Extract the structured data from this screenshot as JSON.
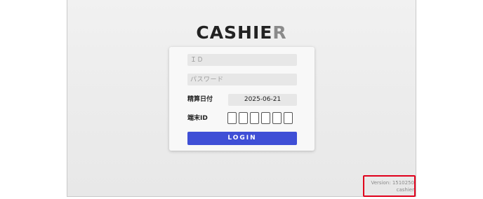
{
  "logo": {
    "main": "CASHIE",
    "accent": "R"
  },
  "form": {
    "id_placeholder": "ＩＤ",
    "password_placeholder": "パスワード",
    "date_label": "精算日付",
    "date_value": "2025-06-21",
    "terminal_label": "端末ID",
    "terminal_digits": [
      "",
      "",
      "",
      "",
      "",
      ""
    ],
    "login_label": "LOGIN"
  },
  "footer": {
    "version": "Version: 1510250",
    "user": "cashier"
  },
  "colors": {
    "login_button": "#3f4fd6",
    "highlight_border": "#e0001b",
    "logo_accent": "#8a8a8a"
  }
}
